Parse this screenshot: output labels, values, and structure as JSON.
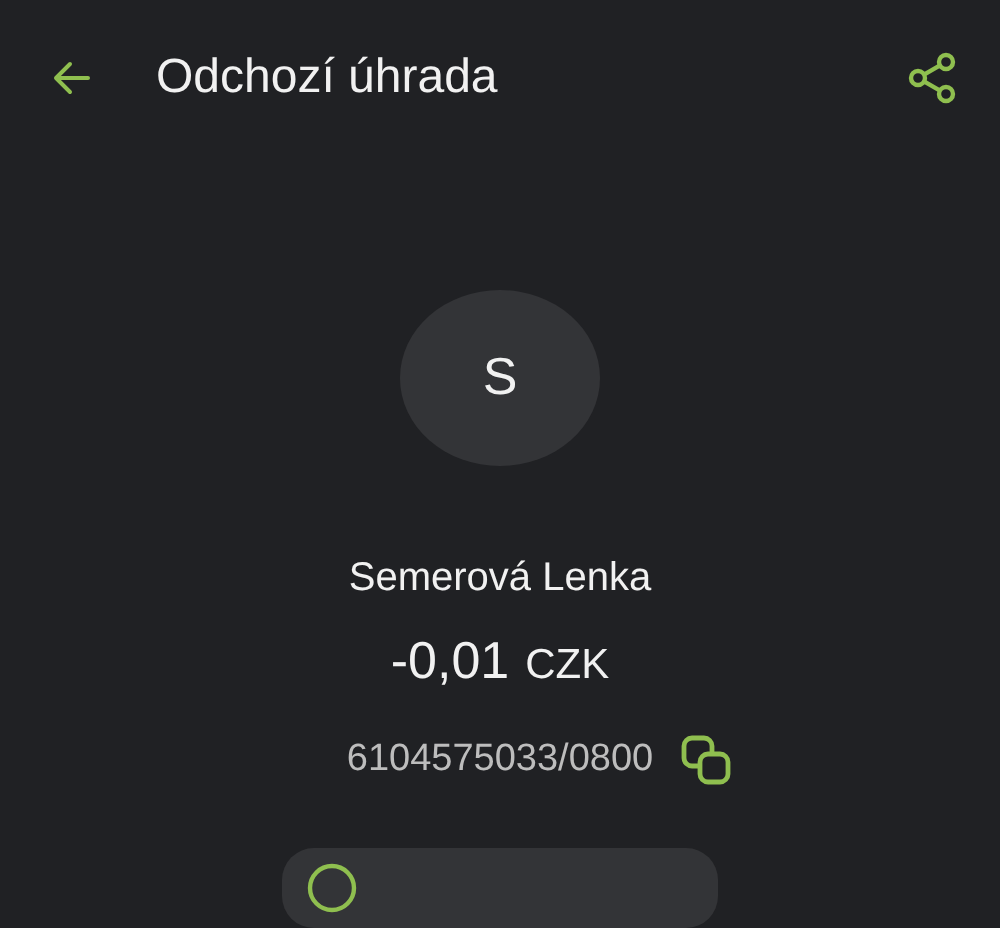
{
  "header": {
    "title": "Odchozí úhrada"
  },
  "counterparty": {
    "initial": "S",
    "name": "Semerová Lenka"
  },
  "amount": {
    "value": "-0,01",
    "currency": "CZK"
  },
  "account": {
    "number": "6104575033/0800"
  }
}
